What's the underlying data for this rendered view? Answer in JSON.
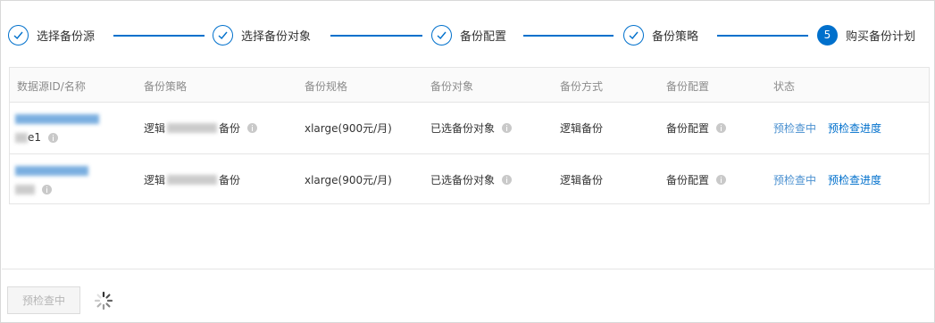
{
  "steps": [
    {
      "label": "选择备份源",
      "state": "done"
    },
    {
      "label": "选择备份对象",
      "state": "done"
    },
    {
      "label": "备份配置",
      "state": "done"
    },
    {
      "label": "备份策略",
      "state": "done"
    },
    {
      "label": "购买备份计划",
      "state": "active",
      "number": "5"
    }
  ],
  "table": {
    "headers": [
      "数据源ID/名称",
      "备份策略",
      "备份规格",
      "备份对象",
      "备份方式",
      "备份配置",
      "状态"
    ],
    "rows": [
      {
        "source_id": "",
        "source_name_suffix": "e1",
        "policy_prefix": "逻辑",
        "policy_suffix": "备份",
        "spec": "xlarge(900元/月)",
        "object": "已选备份对象",
        "method": "逻辑备份",
        "config": "备份配置",
        "status_precheck": "预检查中",
        "status_progress": "预检查进度"
      },
      {
        "source_id": "",
        "source_name_suffix": "",
        "policy_prefix": "逻辑",
        "policy_suffix": "备份",
        "spec": "xlarge(900元/月)",
        "object": "已选备份对象",
        "method": "逻辑备份",
        "config": "备份配置",
        "status_precheck": "预检查中",
        "status_progress": "预检查进度"
      }
    ]
  },
  "footer": {
    "precheck_button": "预检查中"
  },
  "colors": {
    "accent": "#0070cc",
    "muted": "#8c8c8c",
    "border": "#e5e5e5"
  }
}
